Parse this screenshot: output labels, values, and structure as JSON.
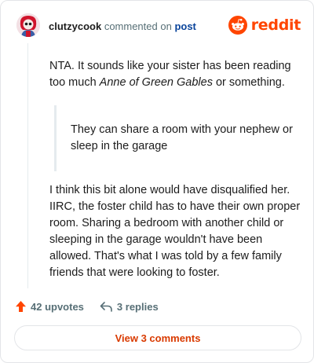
{
  "comment": {
    "username": "clutzycook",
    "action_text": "commented on",
    "post_link": "post",
    "brand": "reddit",
    "paragraph1_before": "NTA. It sounds like your sister has been reading too much ",
    "paragraph1_italic": "Anne of Green Gables",
    "paragraph1_after": " or something.",
    "quote": "They can share a room with your nephew or sleep in the garage",
    "paragraph2": "I think this bit alone would have disqualified her. IIRC, the foster child has to have their own proper room. Sharing a bedroom with another child or sleeping in the garage wouldn't have been allowed. That's what I was told by a few family friends that were looking to foster."
  },
  "footer": {
    "upvotes": "42 upvotes",
    "replies": "3 replies",
    "view_comments": "View 3 comments"
  },
  "colors": {
    "brand": "#ff4500",
    "link": "#0a449b",
    "muted": "#576f76",
    "button_text": "#d93a00"
  },
  "icons": [
    "avatar",
    "reddit-snoo-icon",
    "upvote-arrow-icon",
    "reply-arrow-icon"
  ]
}
